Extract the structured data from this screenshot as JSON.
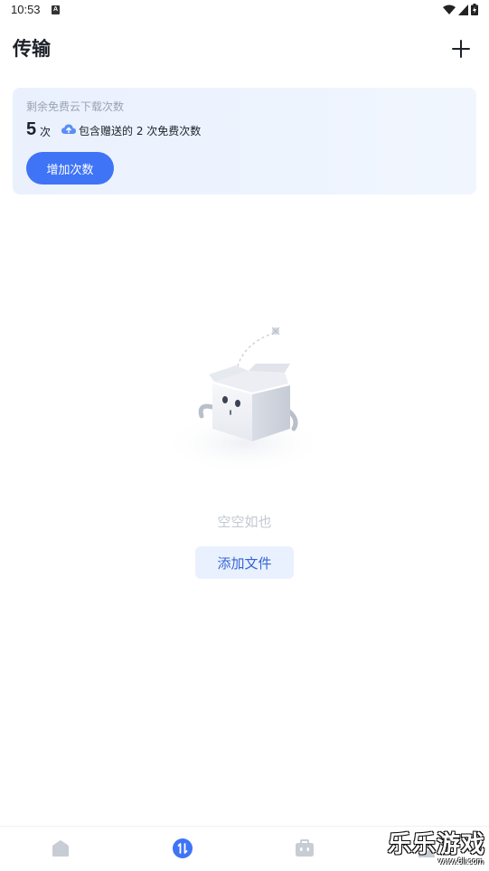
{
  "status_bar": {
    "time": "10:53",
    "notification_icon": "a-icon",
    "icons": [
      "wifi-icon",
      "signal-icon",
      "battery-icon"
    ]
  },
  "header": {
    "title": "传输",
    "action_icon": "plus-icon"
  },
  "quota_card": {
    "label": "剩余免费云下载次数",
    "count": "5",
    "unit": "次",
    "note_icon": "cloud-upload-icon",
    "note": "包含赠送的 2 次免费次数",
    "button_label": "增加次数"
  },
  "empty_state": {
    "illustration": "empty-box-icon",
    "text": "空空如也",
    "button_label": "添加文件"
  },
  "bottom_nav": {
    "items": [
      {
        "icon": "home-icon",
        "active": false
      },
      {
        "icon": "transfer-icon",
        "active": true
      },
      {
        "icon": "toolbox-icon",
        "active": false
      },
      {
        "icon": "profile-icon",
        "active": false
      }
    ]
  },
  "colors": {
    "accent": "#3f74f6",
    "card_bg": "#eaf1fd",
    "muted_text": "#c2c8d2",
    "nav_inactive": "#c8ccd4"
  },
  "watermark": {
    "title": "乐乐游戏",
    "url": "www.6ll.com"
  }
}
